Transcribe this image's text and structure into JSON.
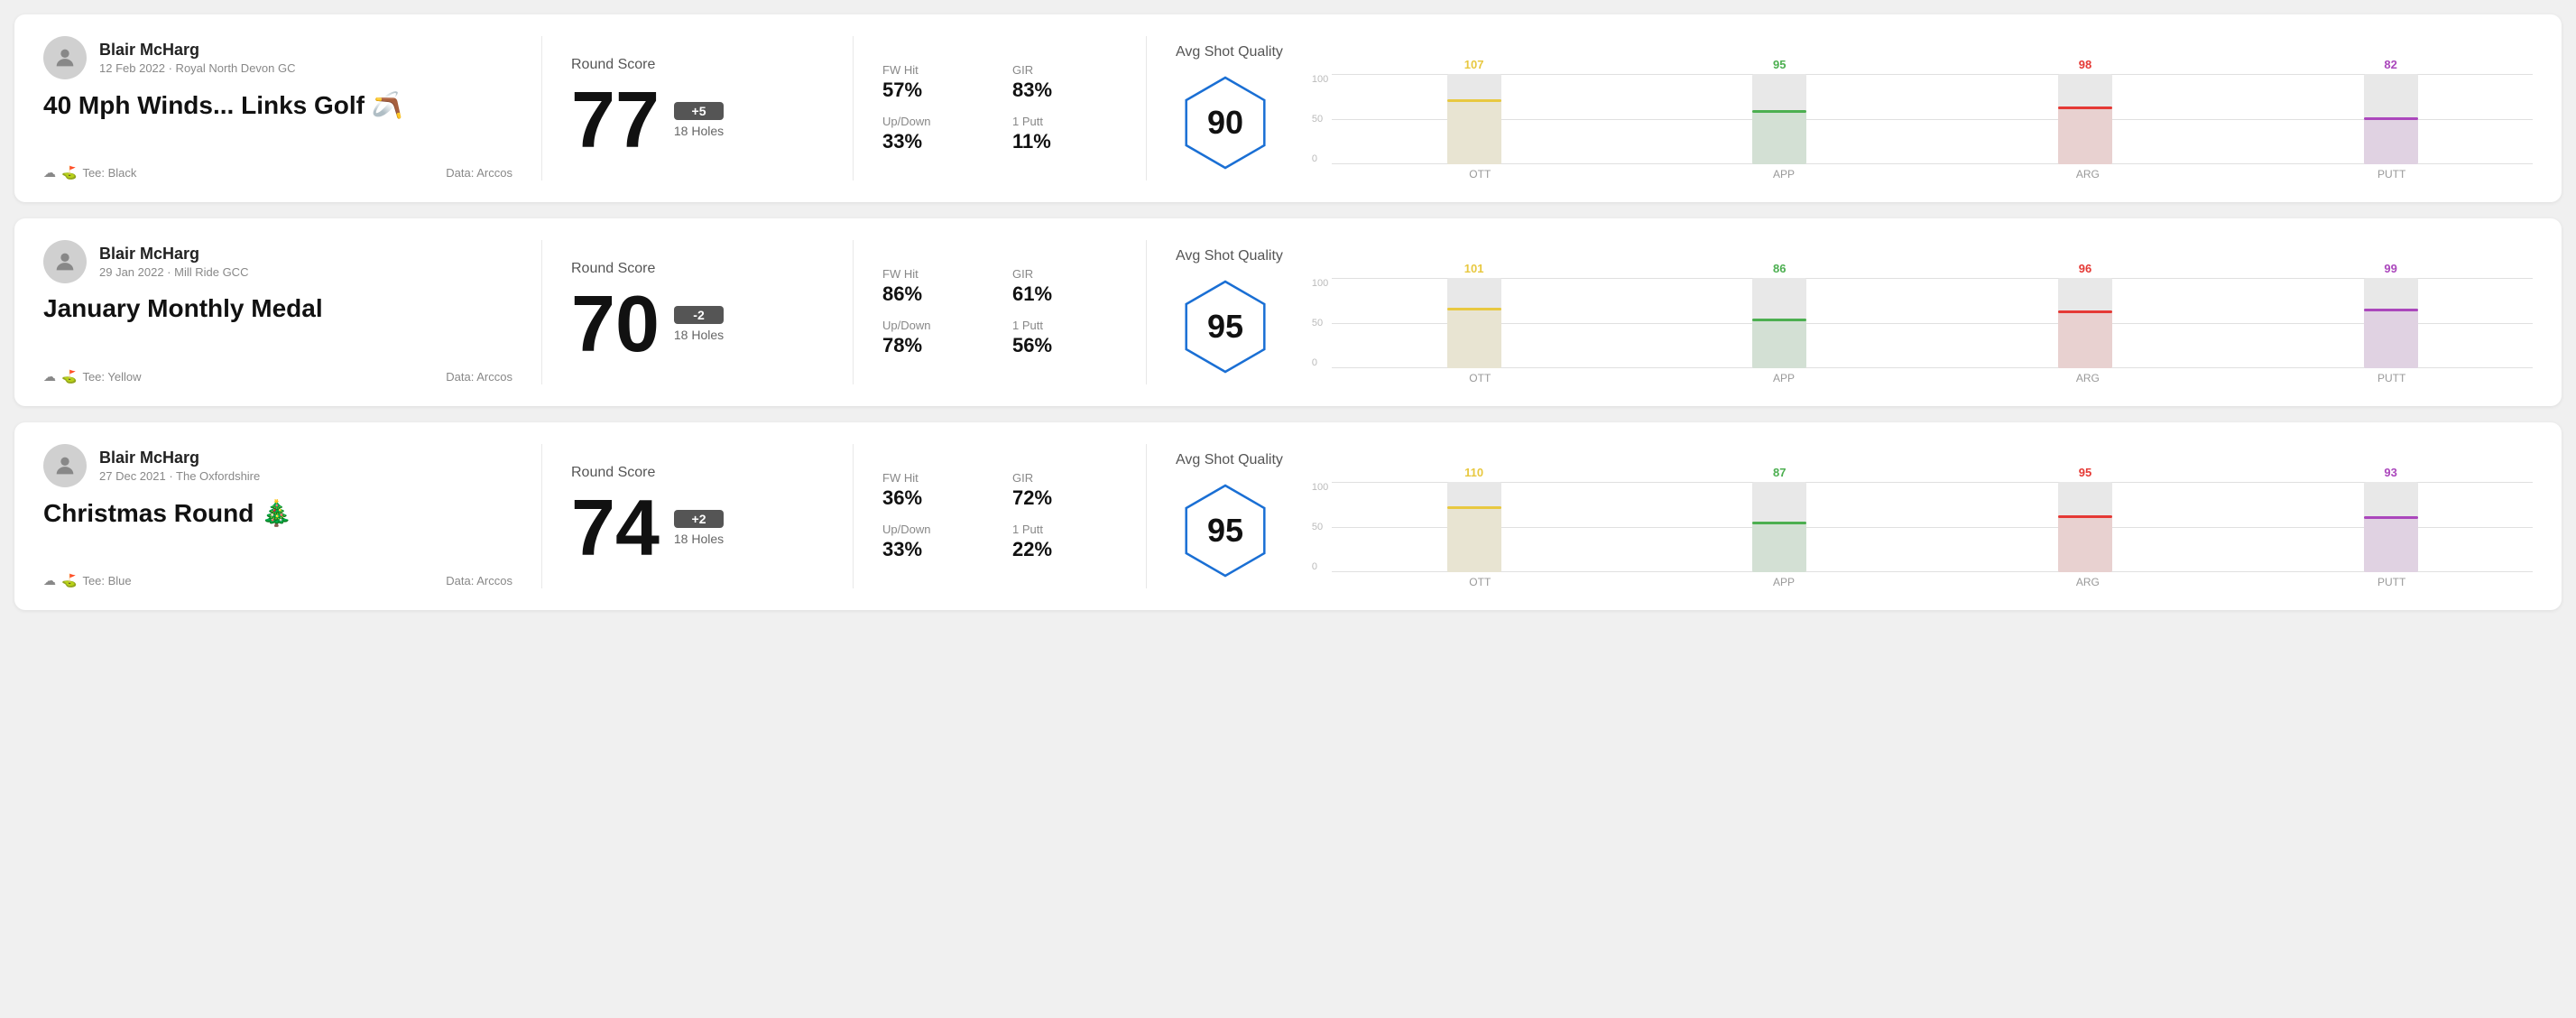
{
  "rounds": [
    {
      "id": "round-1",
      "user": {
        "name": "Blair McHarg",
        "meta": "12 Feb 2022 · Royal North Devon GC"
      },
      "title": "40 Mph Winds... Links Golf",
      "titleEmoji": "🪃",
      "tee": "Black",
      "dataSource": "Data: Arccos",
      "score": {
        "label": "Round Score",
        "value": "77",
        "badge": "+5",
        "holes": "18 Holes"
      },
      "stats": [
        {
          "label": "FW Hit",
          "value": "57%"
        },
        {
          "label": "GIR",
          "value": "83%"
        },
        {
          "label": "Up/Down",
          "value": "33%"
        },
        {
          "label": "1 Putt",
          "value": "11%"
        }
      ],
      "quality": {
        "label": "Avg Shot Quality",
        "value": "90"
      },
      "chart": {
        "bars": [
          {
            "label": "OTT",
            "value": 107,
            "color": "#e8c840",
            "pct": 72
          },
          {
            "label": "APP",
            "value": 95,
            "color": "#4caf50",
            "pct": 60
          },
          {
            "label": "ARG",
            "value": 98,
            "color": "#e53935",
            "pct": 64
          },
          {
            "label": "PUTT",
            "value": 82,
            "color": "#ab47bc",
            "pct": 52
          }
        ],
        "yLabels": [
          "100",
          "50",
          "0"
        ]
      }
    },
    {
      "id": "round-2",
      "user": {
        "name": "Blair McHarg",
        "meta": "29 Jan 2022 · Mill Ride GCC"
      },
      "title": "January Monthly Medal",
      "titleEmoji": "",
      "tee": "Yellow",
      "dataSource": "Data: Arccos",
      "score": {
        "label": "Round Score",
        "value": "70",
        "badge": "-2",
        "holes": "18 Holes"
      },
      "stats": [
        {
          "label": "FW Hit",
          "value": "86%"
        },
        {
          "label": "GIR",
          "value": "61%"
        },
        {
          "label": "Up/Down",
          "value": "78%"
        },
        {
          "label": "1 Putt",
          "value": "56%"
        }
      ],
      "quality": {
        "label": "Avg Shot Quality",
        "value": "95"
      },
      "chart": {
        "bars": [
          {
            "label": "OTT",
            "value": 101,
            "color": "#e8c840",
            "pct": 67
          },
          {
            "label": "APP",
            "value": 86,
            "color": "#4caf50",
            "pct": 55
          },
          {
            "label": "ARG",
            "value": 96,
            "color": "#e53935",
            "pct": 64
          },
          {
            "label": "PUTT",
            "value": 99,
            "color": "#ab47bc",
            "pct": 66
          }
        ],
        "yLabels": [
          "100",
          "50",
          "0"
        ]
      }
    },
    {
      "id": "round-3",
      "user": {
        "name": "Blair McHarg",
        "meta": "27 Dec 2021 · The Oxfordshire"
      },
      "title": "Christmas Round",
      "titleEmoji": "🎄",
      "tee": "Blue",
      "dataSource": "Data: Arccos",
      "score": {
        "label": "Round Score",
        "value": "74",
        "badge": "+2",
        "holes": "18 Holes"
      },
      "stats": [
        {
          "label": "FW Hit",
          "value": "36%"
        },
        {
          "label": "GIR",
          "value": "72%"
        },
        {
          "label": "Up/Down",
          "value": "33%"
        },
        {
          "label": "1 Putt",
          "value": "22%"
        }
      ],
      "quality": {
        "label": "Avg Shot Quality",
        "value": "95"
      },
      "chart": {
        "bars": [
          {
            "label": "OTT",
            "value": 110,
            "color": "#e8c840",
            "pct": 73
          },
          {
            "label": "APP",
            "value": 87,
            "color": "#4caf50",
            "pct": 56
          },
          {
            "label": "ARG",
            "value": 95,
            "color": "#e53935",
            "pct": 63
          },
          {
            "label": "PUTT",
            "value": 93,
            "color": "#ab47bc",
            "pct": 62
          }
        ],
        "yLabels": [
          "100",
          "50",
          "0"
        ]
      }
    }
  ]
}
